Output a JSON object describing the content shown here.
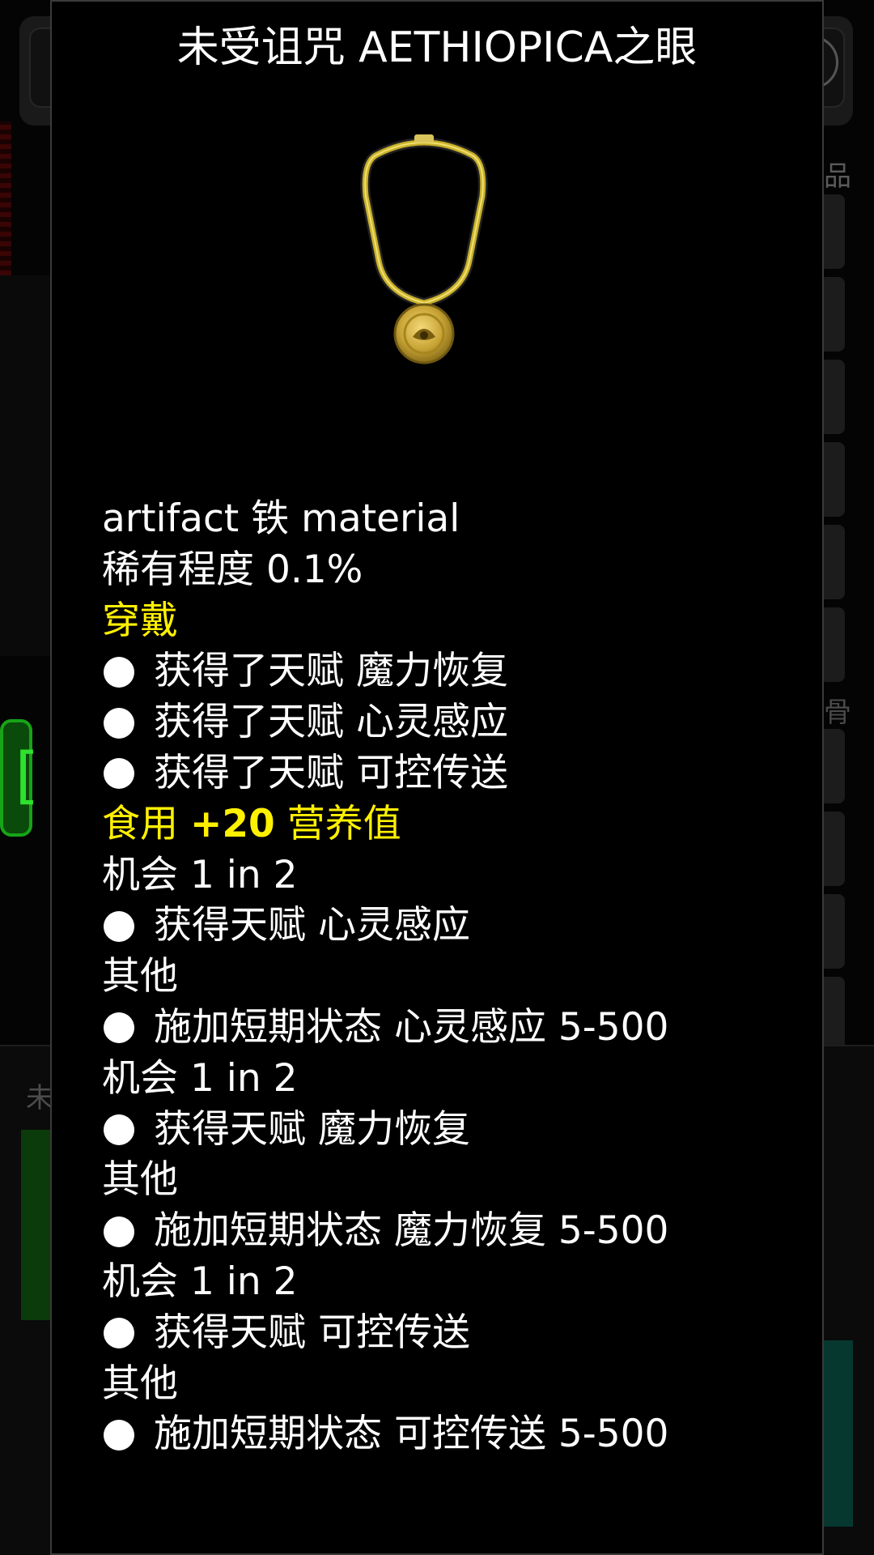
{
  "background": {
    "left_bottom_text": "未",
    "right_top_text": "品",
    "right_mid_text": "骨",
    "bracket_glyph": "["
  },
  "item": {
    "title": "未受诅咒 AETHIOPICA之眼",
    "image_icon": "amulet-necklace-icon",
    "material_line": "artifact 铁 material",
    "rarity_line": "稀有程度 0.1%",
    "wear_heading": "穿戴",
    "wear_effects": [
      "获得了天赋 魔力恢复",
      "获得了天赋 心灵感应",
      "获得了天赋 可控传送"
    ],
    "eat_heading_prefix": "食用 ",
    "eat_heading_number": "+20",
    "eat_heading_suffix": " 营养值",
    "chance_blocks": [
      {
        "chance": "机会 1 in 2",
        "effect": "获得天赋 心灵感应",
        "otherwise": "其他",
        "otherwise_effect": "施加短期状态 心灵感应 5-500"
      },
      {
        "chance": "机会 1 in 2",
        "effect": "获得天赋 魔力恢复",
        "otherwise": "其他",
        "otherwise_effect": "施加短期状态 魔力恢复 5-500"
      },
      {
        "chance": "机会 1 in 2",
        "effect": "获得天赋 可控传送",
        "otherwise": "其他",
        "otherwise_effect": "施加短期状态 可控传送 5-500"
      }
    ]
  },
  "colors": {
    "dialog_background": "#000000",
    "text": "#ffffff",
    "heading_accent": "#fff000",
    "background_green": "#17a417"
  }
}
